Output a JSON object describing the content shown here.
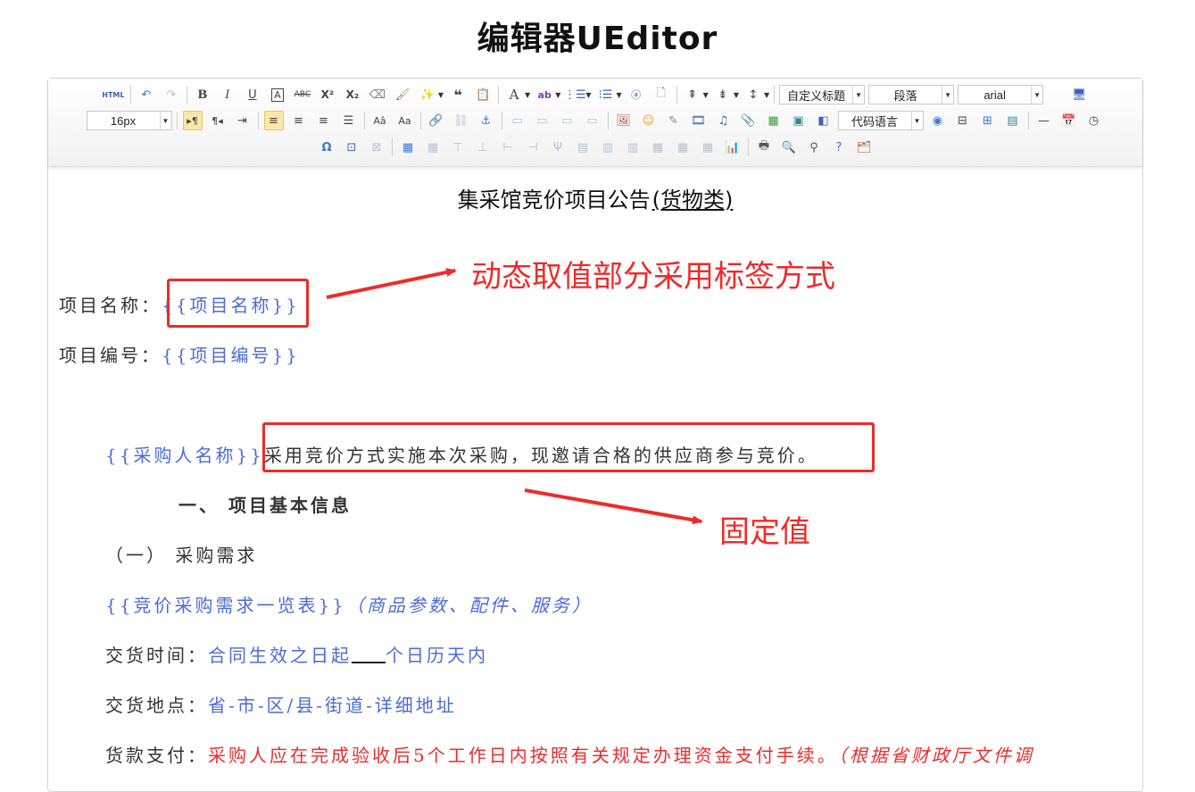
{
  "page": {
    "title": "编辑器UEditor"
  },
  "toolbar": {
    "html_label": "HTML",
    "font_size": "16px",
    "custom_heading": "自定义标题",
    "paragraph": "段落",
    "font_family": "arial",
    "code_language": "代码语言"
  },
  "document": {
    "title": "集采馆竞价项目公告",
    "title_suffix": "(货物类)",
    "project_name_label": "项目名称：",
    "project_name_tag": "{{项目名称}}",
    "project_number_label": "项目编号：",
    "project_number_tag": "{{项目编号}}",
    "purchaser_tag": "{{采购人名称}}",
    "purchaser_text": "采用竞价方式实施本次采购，现邀请合格的供应商参与竞价。",
    "section1": "一、 项目基本信息",
    "subsection1": "（一） 采购需求",
    "demand_tag": "{{竞价采购需求一览表}}",
    "demand_note": "（商品参数、配件、服务）",
    "delivery_time_label": "交货时间：",
    "delivery_time_value_a": "合同生效之日起",
    "delivery_time_value_b": "个日历天内",
    "delivery_place_label": "交货地点：",
    "delivery_place_value": "省-市-区/县-街道-详细地址",
    "payment_label": "货款支付：",
    "payment_value": "采购人应在完成验收后5个工作日内按照有关规定办理资金支付手续。",
    "payment_note": "（根据省财政厅文件调"
  },
  "annotations": {
    "dynamic": "动态取值部分采用标签方式",
    "fixed": "固定值",
    "color": "#ef2a2a"
  }
}
